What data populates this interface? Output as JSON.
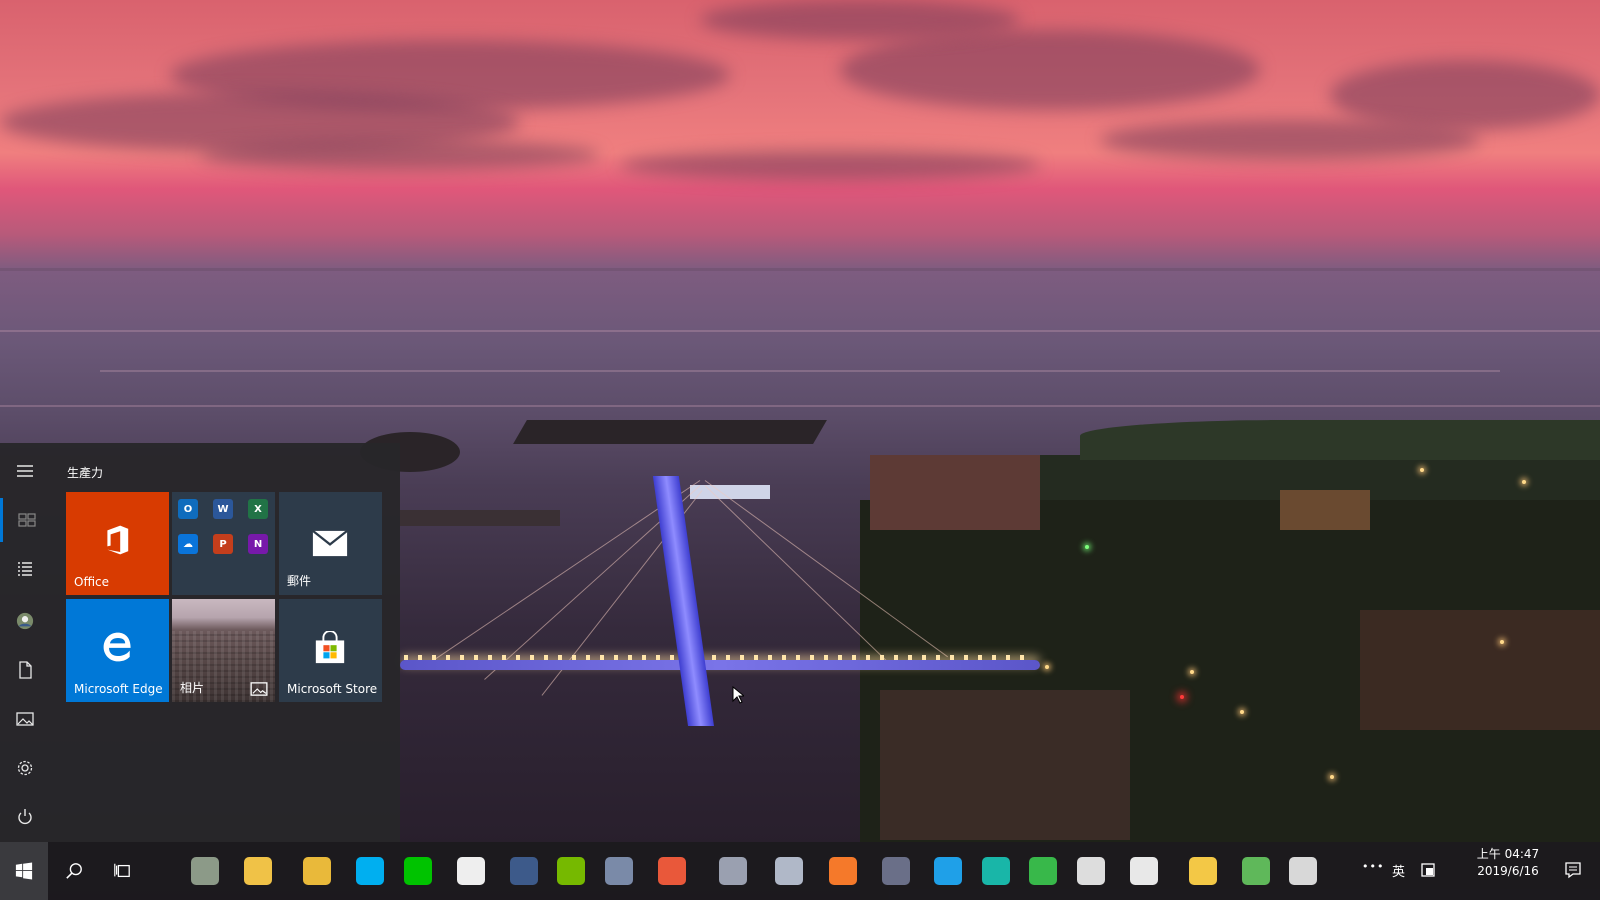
{
  "start_menu": {
    "group_title": "生產力",
    "rail": [
      {
        "name": "hamburger-menu-icon"
      },
      {
        "name": "tiles-view-icon"
      },
      {
        "name": "all-apps-list-icon"
      },
      {
        "name": "user-avatar-icon"
      },
      {
        "name": "documents-icon"
      },
      {
        "name": "pictures-icon"
      },
      {
        "name": "settings-gear-icon"
      },
      {
        "name": "power-icon"
      }
    ],
    "tiles": {
      "office": {
        "label": "Office",
        "color": "#d83b01"
      },
      "office_apps": {
        "icons": [
          "outlook-icon",
          "word-icon",
          "excel-icon",
          "onedrive-icon",
          "powerpoint-icon",
          "onenote-icon"
        ]
      },
      "mail": {
        "label": "郵件",
        "color": "#2d3b4a"
      },
      "edge": {
        "label": "Microsoft Edge",
        "color": "#0078d7"
      },
      "photos": {
        "label": "相片"
      },
      "store": {
        "label": "Microsoft Store",
        "color": "#2d3b4a"
      }
    }
  },
  "taskbar": {
    "pinned": [
      {
        "name": "recycle-bin-icon",
        "color": "#8c9a88"
      },
      {
        "name": "file-explorer-icon",
        "color": "#f0c247"
      },
      {
        "name": "chrome-icon",
        "color": "#e9b93a"
      },
      {
        "name": "skype-icon",
        "color": "#00aff0"
      },
      {
        "name": "line-icon",
        "color": "#00c300"
      },
      {
        "name": "music-player-icon",
        "color": "#eeeeee"
      },
      {
        "name": "steam-icon",
        "color": "#3d5a8a"
      },
      {
        "name": "nvidia-icon",
        "color": "#76b900"
      },
      {
        "name": "cube-app-icon",
        "color": "#7a8aa8"
      },
      {
        "name": "photo-viewer-icon",
        "color": "#e9583a"
      },
      {
        "name": "cat-app-icon",
        "color": "#9aa0b0"
      },
      {
        "name": "ship-app-icon",
        "color": "#b0b8c8"
      },
      {
        "name": "blender-icon",
        "color": "#f5792a"
      },
      {
        "name": "video-editor-icon",
        "color": "#6a6f88"
      },
      {
        "name": "headphones-app-icon",
        "color": "#1fa0e8"
      },
      {
        "name": "drop-app-icon",
        "color": "#19b6a8"
      },
      {
        "name": "home-app-icon",
        "color": "#38b84a"
      },
      {
        "name": "piano-app-icon",
        "color": "#dddddd"
      },
      {
        "name": "calculator-icon",
        "color": "#e8e8e8"
      },
      {
        "name": "notes-app-icon",
        "color": "#f3c846"
      },
      {
        "name": "money-app-icon",
        "color": "#5fb85a"
      },
      {
        "name": "tool-app-icon",
        "color": "#d8d8d8"
      }
    ],
    "tray": {
      "overflow": "•••",
      "ime": "英",
      "time": "上午 04:47",
      "date": "2019/6/16"
    }
  }
}
